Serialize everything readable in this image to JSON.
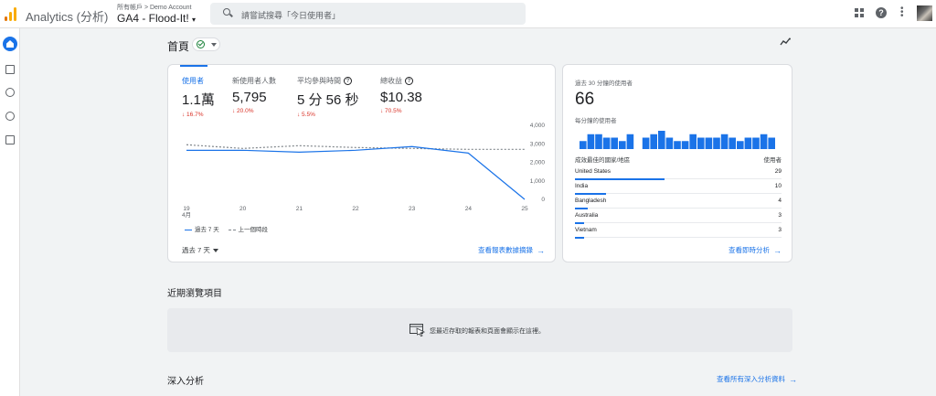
{
  "app": {
    "title": "Analytics (分析)"
  },
  "breadcrumb": "所有帳戶 > Demo Account",
  "property": "GA4 - Flood-It!",
  "search": {
    "placeholder": "請嘗試搜尋「今日使用者」"
  },
  "colors": {
    "accent": "#1a73e8",
    "negative": "#d93025",
    "positive": "#188038"
  },
  "page": {
    "title": "首頁"
  },
  "metrics": [
    {
      "label": "使用者",
      "value": "1.1萬",
      "change": "↓ 16.7%"
    },
    {
      "label": "新使用者人數",
      "value": "5,795",
      "change": "↓ 20.0%"
    },
    {
      "label": "平均參與時間",
      "value": "5 分 56 秒",
      "change": "↓ 5.5%"
    },
    {
      "label": "總收益",
      "value": "$10.38",
      "change": "↓ 70.5%"
    }
  ],
  "chart_data": {
    "type": "line",
    "x": [
      "19",
      "20",
      "21",
      "22",
      "23",
      "24",
      "25"
    ],
    "x_sublabel": "4月",
    "y_ticks": [
      "4,000",
      "3,000",
      "2,000",
      "1,000",
      "0"
    ],
    "ylim": [
      0,
      4000
    ],
    "grid": false,
    "legend_position": "bottom-left",
    "series": [
      {
        "name": "過去 7 天",
        "style": "solid",
        "values": [
          2650,
          2650,
          2550,
          2650,
          2850,
          2500,
          0
        ]
      },
      {
        "name": "上一個時段",
        "style": "dashed",
        "values": [
          2950,
          2750,
          2900,
          2800,
          2750,
          2700,
          2700
        ]
      }
    ]
  },
  "legend": {
    "current": "過去 7 天",
    "previous": "上一個時段"
  },
  "range": "過去 7 天",
  "report_link": "查看報表數據摘錄",
  "realtime": {
    "title": "過去 30 分鐘的使用者",
    "value": "66",
    "subtitle": "每分鐘的使用者",
    "per_minute": [
      1,
      3,
      3,
      2,
      2,
      1,
      3,
      0,
      2,
      3,
      4,
      2,
      1,
      1,
      3,
      2,
      2,
      2,
      3,
      2,
      1,
      2,
      2,
      3,
      2
    ],
    "header_country": "成效最佳的國家/地區",
    "header_users": "使用者",
    "countries": [
      {
        "name": "United States",
        "users": 29
      },
      {
        "name": "India",
        "users": 10
      },
      {
        "name": "Bangladesh",
        "users": 4
      },
      {
        "name": "Australia",
        "users": 3
      },
      {
        "name": "Vietnam",
        "users": 3
      }
    ],
    "link": "查看即時分析"
  },
  "recent": {
    "title": "近期瀏覽項目",
    "empty_text": "您最近存取的報表和頁面會顯示在這裡。"
  },
  "insights": {
    "title": "深入分析",
    "link": "查看所有深入分析資料"
  }
}
